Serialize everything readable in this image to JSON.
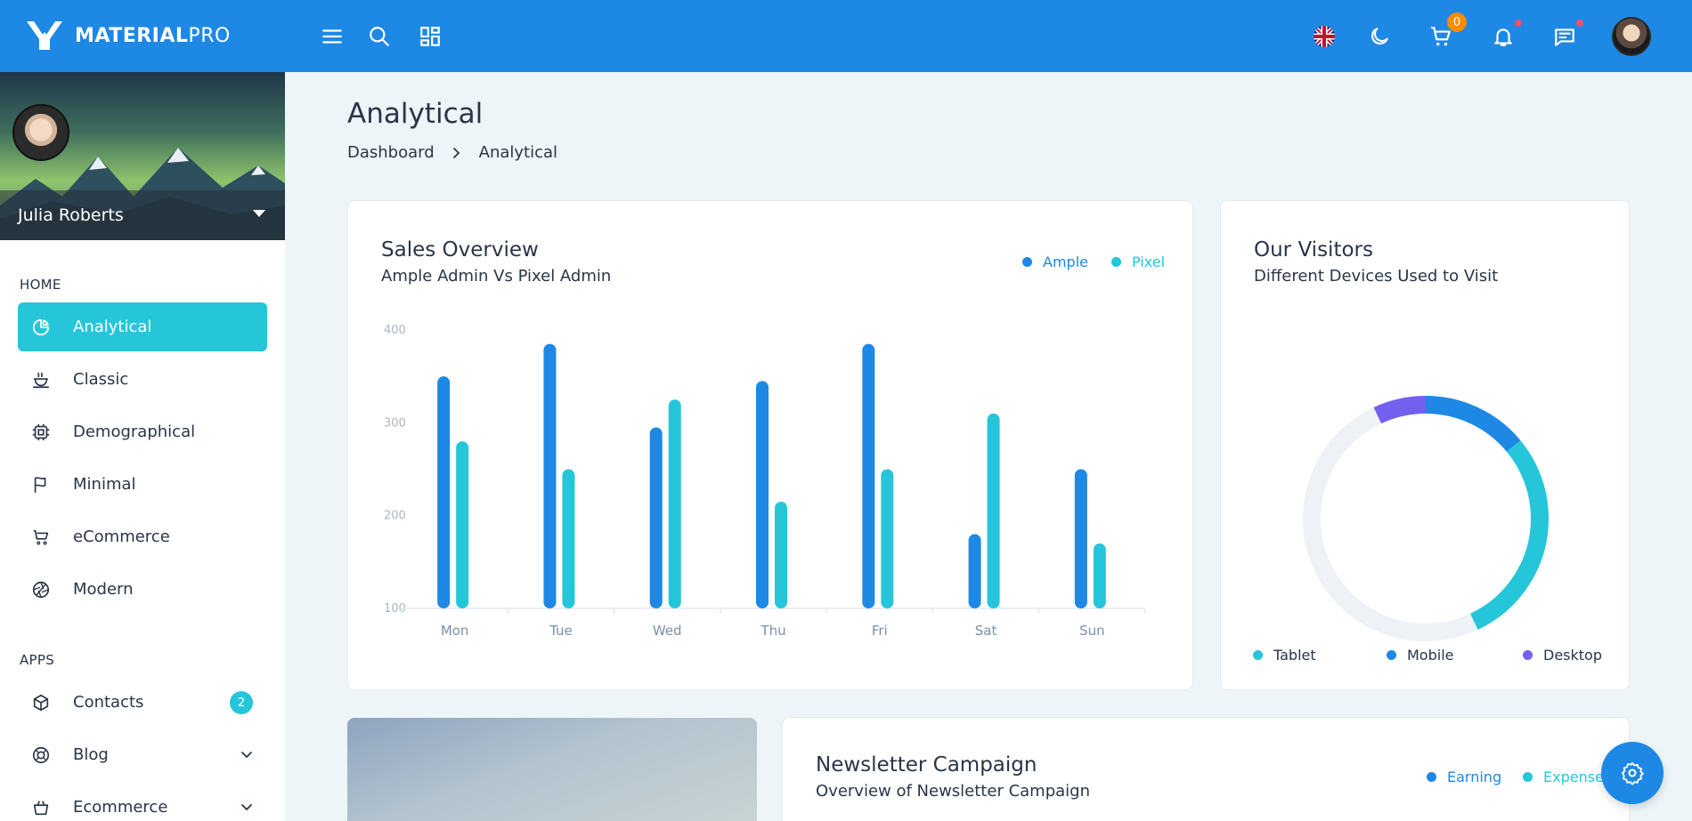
{
  "brand": {
    "bold": "MATERIAL",
    "light": "PRO"
  },
  "topbar": {
    "cart_count": "0"
  },
  "sidebar": {
    "user_name": "Julia Roberts",
    "sections": [
      {
        "caption": "HOME"
      },
      {
        "caption": "APPS"
      }
    ],
    "items": [
      {
        "label": "Analytical"
      },
      {
        "label": "Classic"
      },
      {
        "label": "Demographical"
      },
      {
        "label": "Minimal"
      },
      {
        "label": "eCommerce"
      },
      {
        "label": "Modern"
      },
      {
        "label": "Contacts",
        "badge": "2"
      },
      {
        "label": "Blog"
      },
      {
        "label": "Ecommerce"
      }
    ]
  },
  "page": {
    "title": "Analytical",
    "breadcrumb": [
      "Dashboard",
      "Analytical"
    ]
  },
  "sales": {
    "title": "Sales Overview",
    "subtitle": "Ample Admin Vs Pixel Admin"
  },
  "visitors": {
    "title": "Our Visitors",
    "subtitle": "Different Devices Used to Visit"
  },
  "newsletter": {
    "title": "Newsletter Campaign",
    "subtitle": "Overview of Newsletter Campaign",
    "legend": [
      "Earning",
      "Expense"
    ]
  },
  "colors": {
    "primary": "#1e88e5",
    "accent": "#26c6da",
    "purple": "#7460ee"
  },
  "chart_data": [
    {
      "type": "bar",
      "categories": [
        "Mon",
        "Tue",
        "Wed",
        "Thu",
        "Fri",
        "Sat",
        "Sun"
      ],
      "series": [
        {
          "name": "Ample",
          "color": "#1e88e5",
          "values": [
            350,
            385,
            295,
            345,
            385,
            180,
            250
          ]
        },
        {
          "name": "Pixel",
          "color": "#26c6da",
          "values": [
            280,
            250,
            325,
            215,
            250,
            310,
            170
          ]
        }
      ],
      "yticks": [
        100,
        200,
        300,
        400
      ],
      "ylim": [
        100,
        400
      ],
      "legend_position": "top-right"
    },
    {
      "type": "pie",
      "donut": true,
      "labels": [
        "Tablet",
        "Mobile",
        "Desktop"
      ],
      "values": [
        29,
        14,
        7
      ],
      "remainder": 50,
      "colors": [
        "#26c6da",
        "#1e88e5",
        "#7460ee"
      ],
      "legend_position": "bottom"
    }
  ]
}
